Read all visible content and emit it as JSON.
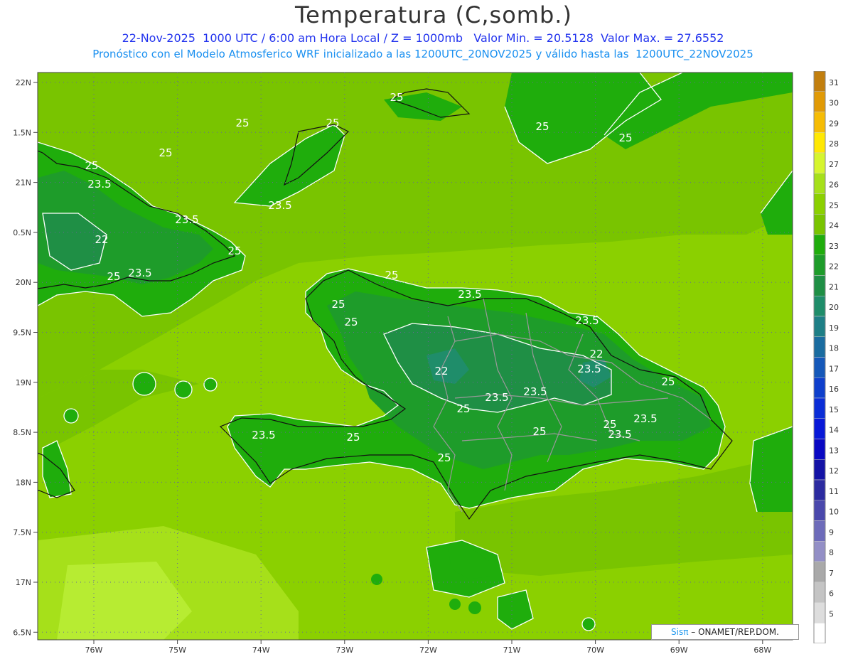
{
  "title": "Temperatura (C,somb.)",
  "subtitle_1": "22-Nov-2025  1000 UTC / 6:00 am Hora Local / Z = 1000mb   Valor Min. = 20.5128  Valor Max. = 27.6552",
  "subtitle_2": "Pronóstico con el Modelo Atmosferico WRF inicializado a las 1200UTC_20NOV2025 y válido hasta las  1200UTC_22NOV2025",
  "credit": {
    "logo": "Sisπ",
    "text": " – ONAMET/REP.DOM."
  },
  "axes": {
    "lat_ticks": [
      "22N",
      "1.5N",
      "21N",
      "0.5N",
      "20N",
      "9.5N",
      "19N",
      "8.5N",
      "18N",
      "7.5N",
      "17N",
      "6.5N"
    ],
    "lon_ticks": [
      "76W",
      "75W",
      "74W",
      "73W",
      "72W",
      "71W",
      "70W",
      "69W",
      "68W"
    ]
  },
  "legend": {
    "levels": [
      "31",
      "30",
      "29",
      "28",
      "27",
      "26",
      "25",
      "24",
      "23",
      "22",
      "21",
      "20",
      "19",
      "18",
      "17",
      "16",
      "15",
      "14",
      "13",
      "12",
      "11",
      "10",
      "9",
      "8",
      "7",
      "6",
      "5"
    ],
    "colors": [
      "#c27f0e",
      "#e19a05",
      "#f6bc04",
      "#ffe803",
      "#d6f52e",
      "#a6e01a",
      "#8bd000",
      "#79c400",
      "#1fad0c",
      "#1e9c2a",
      "#1f8f45",
      "#1f8d6a",
      "#1e7f86",
      "#1a6ca0",
      "#1558b9",
      "#0e3fcc",
      "#0a2dd7",
      "#0818d8",
      "#0908c3",
      "#1413a6",
      "#2c2ba0",
      "#4a48ac",
      "#6d6bba",
      "#938fc6",
      "#a9a9a9",
      "#c4c4c4",
      "#dddddd",
      "#ffffff"
    ]
  },
  "contour_labels": [
    "25",
    "25",
    "25",
    "25",
    "25",
    "25",
    "25",
    "23.5",
    "23.5",
    "22",
    "25",
    "23.5",
    "25",
    "23.5",
    "25",
    "23.5",
    "25",
    "25",
    "23.5",
    "22",
    "22",
    "23.5",
    "23.5",
    "23.5",
    "25",
    "25",
    "23.5",
    "25",
    "23.5",
    "23.5",
    "25",
    "25",
    "25"
  ]
}
